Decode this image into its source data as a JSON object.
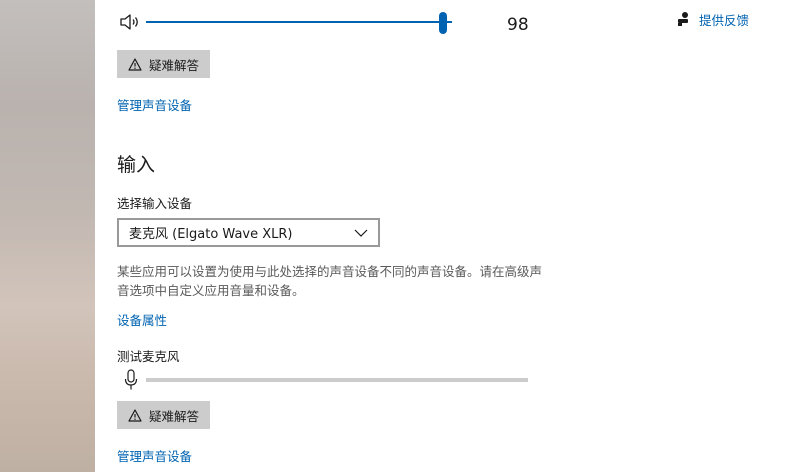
{
  "output": {
    "volume_value": "98",
    "volume_level_percent": 98,
    "troubleshoot_label": "疑难解答",
    "manage_devices_link": "管理声音设备"
  },
  "feedback": {
    "label": "提供反馈"
  },
  "input": {
    "title": "输入",
    "select_label": "选择输入设备",
    "selected_device": "麦克风 (Elgato Wave XLR)",
    "description": "某些应用可以设置为使用与此处选择的声音设备不同的声音设备。请在高级声音选项中自定义应用音量和设备。",
    "device_properties_link": "设备属性",
    "test_mic_label": "测试麦克风",
    "mic_level_percent": 0,
    "troubleshoot_label": "疑难解答",
    "manage_devices_link": "管理声音设备"
  },
  "colors": {
    "accent": "#0063b1",
    "button_bg": "#cccccc",
    "track": "#cccccc"
  },
  "icons": {
    "speaker": "speaker-icon",
    "feedback": "feedback-icon",
    "warning": "warning-icon",
    "chevron": "chevron-down-icon",
    "microphone": "microphone-icon"
  }
}
